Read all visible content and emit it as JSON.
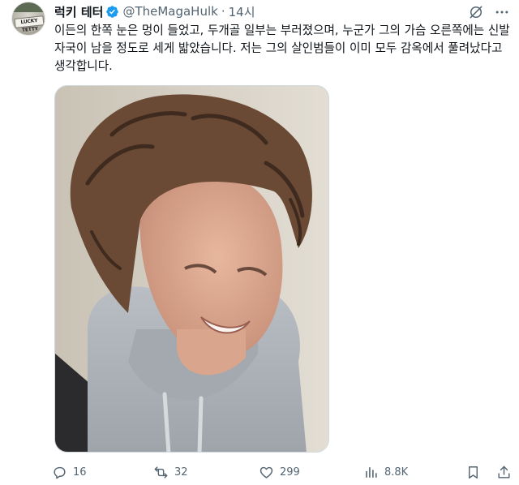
{
  "post": {
    "author": {
      "display_name": "럭키 테터",
      "handle": "@TheMagaHulk",
      "avatar_text": "LUCKY TETTY",
      "verified": true
    },
    "separator": "·",
    "time": "14시",
    "text": "이든의 한쪽 눈은 멍이 들었고, 두개골 일부는 부러졌으며, 누군가 그의 가슴 오른쪽에는 신발 자국이 남을 정도로 세게 밟았습니다. 저는 그의 살인범들이 이미 모두 감옥에서 풀려났다고 생각합니다.",
    "media": {
      "description_icon": "photo"
    },
    "actions": {
      "replies": "16",
      "reposts": "32",
      "likes": "299",
      "views": "8.8K"
    }
  },
  "colors": {
    "text": "#0f1419",
    "secondary": "#536471",
    "verified": "#1d9bf0",
    "border": "#cfd9de"
  }
}
